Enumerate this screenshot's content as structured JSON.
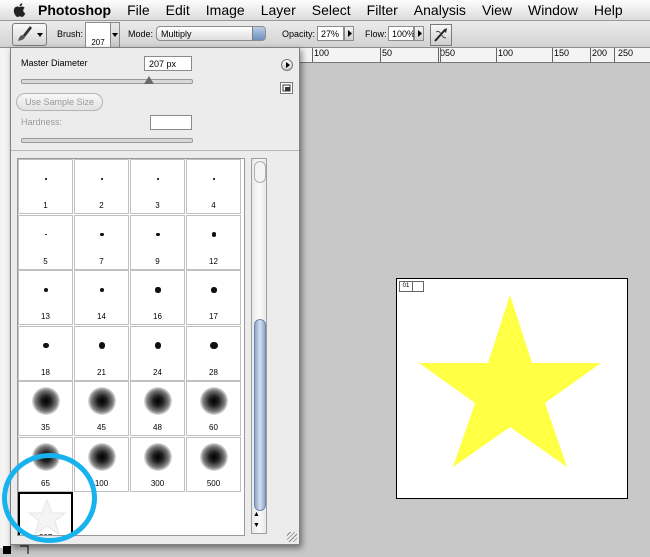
{
  "menubar": {
    "app": "Photoshop",
    "items": [
      "File",
      "Edit",
      "Image",
      "Layer",
      "Select",
      "Filter",
      "Analysis",
      "View",
      "Window",
      "Help"
    ]
  },
  "options_bar": {
    "brush_label": "Brush:",
    "brush_size": "207",
    "mode_label": "Mode:",
    "mode_value": "Multiply",
    "opacity_label": "Opacity:",
    "opacity_value": "27%",
    "flow_label": "Flow:",
    "flow_value": "100%"
  },
  "ruler": {
    "labels": [
      "100",
      "50",
      "0",
      "50",
      "100",
      "150",
      "200",
      "250"
    ]
  },
  "brush_panel": {
    "master_diameter_label": "Master Diameter",
    "master_diameter_value": "207 px",
    "use_sample_size_label": "Use Sample Size",
    "hardness_label": "Hardness:",
    "hardness_value": "",
    "brushes": [
      {
        "size": "1",
        "type": "hard"
      },
      {
        "size": "2",
        "type": "hard"
      },
      {
        "size": "3",
        "type": "hard"
      },
      {
        "size": "4",
        "type": "hard"
      },
      {
        "size": "5",
        "type": "hard"
      },
      {
        "size": "7",
        "type": "hard"
      },
      {
        "size": "9",
        "type": "hard"
      },
      {
        "size": "12",
        "type": "hard"
      },
      {
        "size": "13",
        "type": "hard"
      },
      {
        "size": "14",
        "type": "hard"
      },
      {
        "size": "16",
        "type": "hard"
      },
      {
        "size": "17",
        "type": "hard"
      },
      {
        "size": "18",
        "type": "hard"
      },
      {
        "size": "21",
        "type": "hard"
      },
      {
        "size": "24",
        "type": "hard"
      },
      {
        "size": "28",
        "type": "hard"
      },
      {
        "size": "35",
        "type": "soft"
      },
      {
        "size": "45",
        "type": "soft"
      },
      {
        "size": "48",
        "type": "soft"
      },
      {
        "size": "60",
        "type": "soft"
      },
      {
        "size": "65",
        "type": "soft"
      },
      {
        "size": "100",
        "type": "soft"
      },
      {
        "size": "300",
        "type": "soft"
      },
      {
        "size": "500",
        "type": "soft"
      },
      {
        "size": "207",
        "type": "star",
        "selected": true
      }
    ]
  },
  "document": {
    "badge": "01",
    "star_color": "#ffff44"
  },
  "colors": {
    "annotation_circle": "#18b2ee",
    "canvas_background": "#c8c8c8"
  }
}
